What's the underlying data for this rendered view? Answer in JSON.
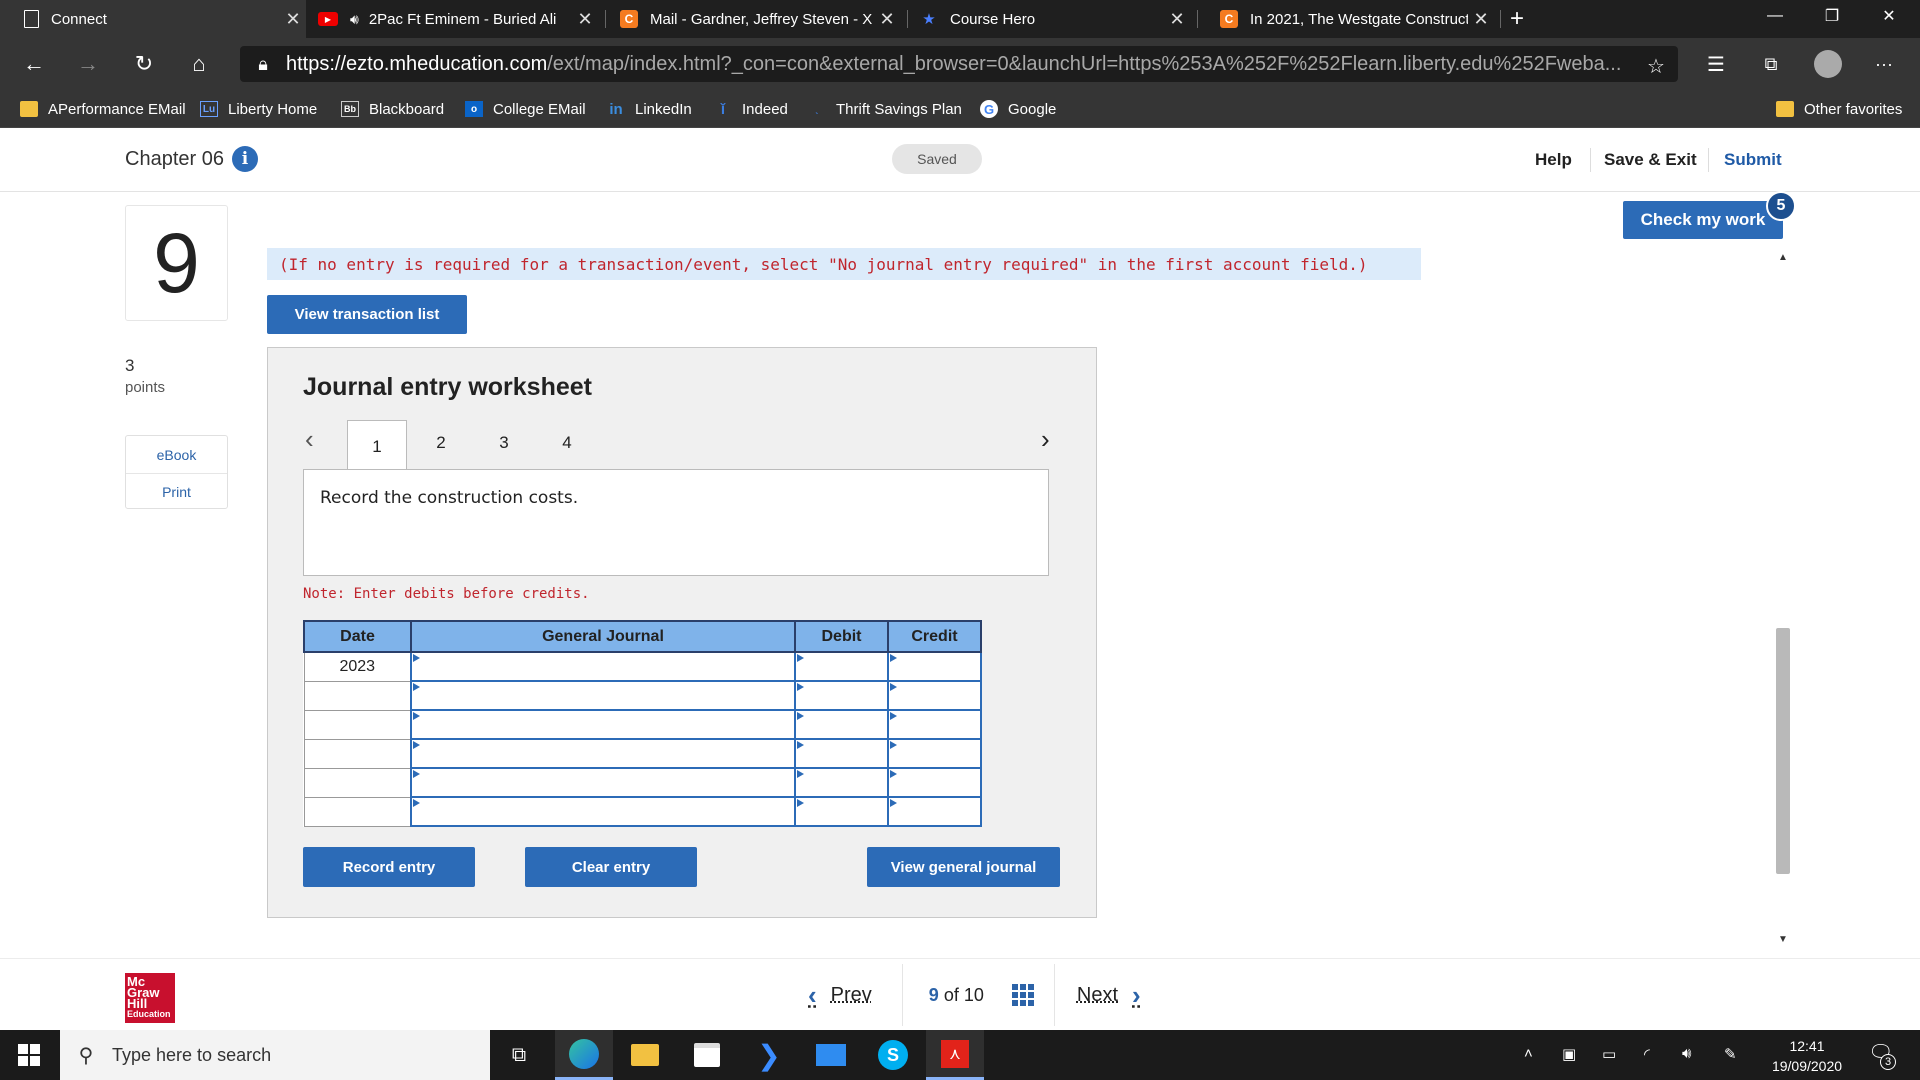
{
  "browser": {
    "tabs": [
      {
        "title": "Connect",
        "icon": "page-icon",
        "active": true
      },
      {
        "title": "2Pac Ft Eminem - Buried Ali",
        "icon": "youtube-icon",
        "audio": true
      },
      {
        "title": "Mail - Gardner, Jeffrey Steven - X",
        "icon": "chegg-icon"
      },
      {
        "title": "Course Hero",
        "icon": "coursehero-icon"
      },
      {
        "title": "In 2021, The Westgate Construct",
        "icon": "chegg-icon"
      }
    ],
    "new_tab_glyph": "+",
    "url_host": "https://ezto.mheducation.com",
    "url_path": "/ext/map/index.html?_con=con&external_browser=0&launchUrl=https%253A%252F%252Flearn.liberty.edu%252Fweba...",
    "bookmarks": [
      {
        "label": "APerformance EMail",
        "icon": "folder-icon"
      },
      {
        "label": "Liberty Home",
        "icon": "liberty-icon"
      },
      {
        "label": "Blackboard",
        "icon": "blackboard-icon"
      },
      {
        "label": "College EMail",
        "icon": "outlook-icon"
      },
      {
        "label": "LinkedIn",
        "icon": "linkedin-icon"
      },
      {
        "label": "Indeed",
        "icon": "indeed-icon"
      },
      {
        "label": "Thrift Savings Plan",
        "icon": "tsp-icon"
      },
      {
        "label": "Google",
        "icon": "google-icon"
      }
    ],
    "other_favorites": "Other favorites"
  },
  "header": {
    "chapter": "Chapter 06",
    "saved": "Saved",
    "help": "Help",
    "save_exit": "Save & Exit",
    "submit": "Submit"
  },
  "question": {
    "number": "9",
    "points": "3",
    "points_label": "points",
    "ebook": "eBook",
    "print": "Print"
  },
  "check_my_work": {
    "label": "Check my work",
    "badge": "5"
  },
  "notice": "(If no entry is required for a transaction/event, select \"No journal entry required\" in the first account field.)",
  "view_transaction_list": "View transaction list",
  "worksheet": {
    "title": "Journal entry worksheet",
    "tabs": [
      "1",
      "2",
      "3",
      "4"
    ],
    "active_tab": "1",
    "prompt": "Record the construction costs.",
    "note": "Note: Enter debits before credits.",
    "columns": [
      "Date",
      "General Journal",
      "Debit",
      "Credit"
    ],
    "rows": [
      {
        "date": "2023"
      },
      {
        "date": ""
      },
      {
        "date": ""
      },
      {
        "date": ""
      },
      {
        "date": ""
      },
      {
        "date": ""
      }
    ],
    "record_entry": "Record entry",
    "clear_entry": "Clear entry",
    "view_general_journal": "View general journal"
  },
  "footer": {
    "logo_lines": [
      "Mc",
      "Graw",
      "Hill",
      "Education"
    ],
    "prev": "Prev",
    "current_page": "9",
    "of_text": "of",
    "total_pages": "10",
    "next": "Next"
  },
  "taskbar": {
    "search_placeholder": "Type here to search",
    "time": "12:41",
    "date": "19/09/2020",
    "notification_count": "3"
  },
  "colors": {
    "accent_blue": "#2c6bb7",
    "notice_red": "#c0252d",
    "table_header": "#7fb3ea",
    "brand_red": "#c8102e"
  }
}
